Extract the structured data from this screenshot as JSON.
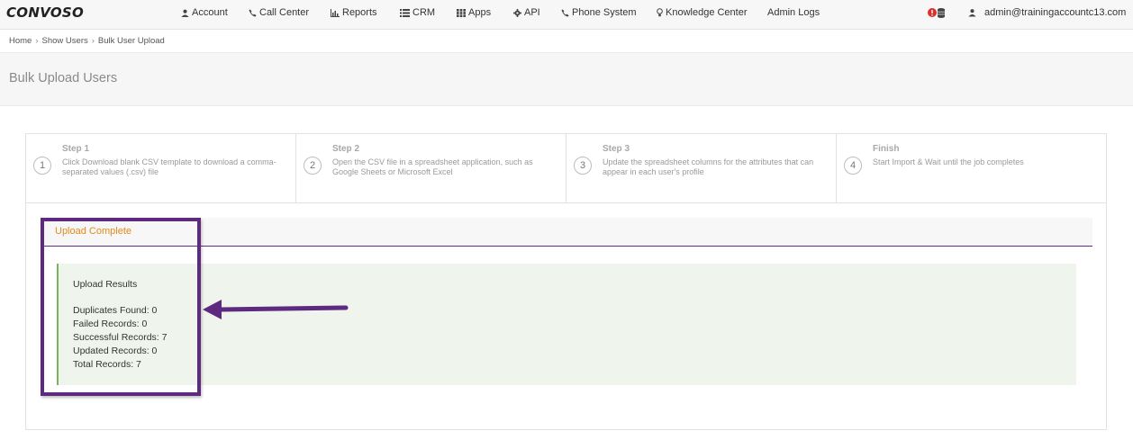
{
  "nav": {
    "logo": "CONVOSO",
    "items": [
      {
        "label": "Account",
        "icon": "user-icon"
      },
      {
        "label": "Call Center",
        "icon": "phone-icon"
      },
      {
        "label": "Reports",
        "icon": "bar-chart-icon"
      },
      {
        "label": "CRM",
        "icon": "list-icon"
      },
      {
        "label": "Apps",
        "icon": "grid-icon"
      },
      {
        "label": "API",
        "icon": "gear-icon"
      },
      {
        "label": "Phone System",
        "icon": "phone-icon"
      },
      {
        "label": "Knowledge Center",
        "icon": "lightbulb-icon"
      },
      {
        "label": "Admin Logs",
        "icon": ""
      }
    ],
    "user_email": "admin@trainingaccountc13.com",
    "alert_color": "#d9312b"
  },
  "breadcrumb": [
    "Home",
    "Show Users",
    "Bulk User Upload"
  ],
  "page_title": "Bulk Upload Users",
  "steps": [
    {
      "num": "1",
      "title": "Step 1",
      "desc": "Click Download blank CSV template to download a comma-separated values (.csv) file"
    },
    {
      "num": "2",
      "title": "Step 2",
      "desc": "Open the CSV file in a spreadsheet application, such as Google Sheets or Microsoft Excel"
    },
    {
      "num": "3",
      "title": "Step 3",
      "desc": "Update the spreadsheet columns for the attributes that can appear in each user's profile"
    },
    {
      "num": "4",
      "title": "Finish",
      "desc": "Start Import & Wait until the job completes"
    }
  ],
  "upload": {
    "tab_label": "Upload Complete",
    "results_title": "Upload Results",
    "lines": [
      "Duplicates Found: 0",
      "Failed Records: 0",
      "Successful Records: 7",
      "Updated Records: 0",
      "Total Records: 7"
    ]
  },
  "colors": {
    "accent_orange": "#e08a1e",
    "annotation_purple": "#5e2a80",
    "success_green": "#77b55a"
  }
}
